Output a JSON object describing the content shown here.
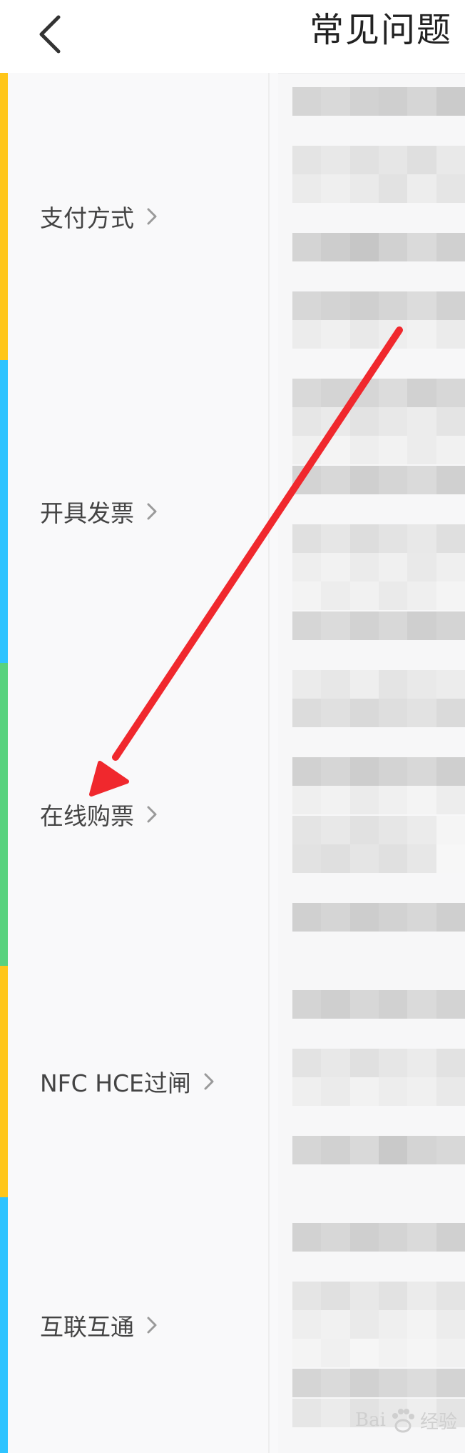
{
  "header": {
    "title": "常见问题",
    "back_icon": "chevron-left-icon"
  },
  "categories": [
    {
      "label": "支付方式",
      "color": "#FFC61A"
    },
    {
      "label": "开具发票",
      "color": "#2DC3FF"
    },
    {
      "label": "在线购票",
      "color": "#58D27D"
    },
    {
      "label": "NFC HCE过闸",
      "color": "#FFC61A"
    },
    {
      "label": "互联互通",
      "color": "#2DC3FF"
    }
  ],
  "annotation": {
    "arrow_color": "#F0282D",
    "arrow_points_to": "在线购票"
  },
  "watermark": {
    "text_left": "Bai",
    "text_right": "经验",
    "icon": "baidu-paw-icon"
  }
}
